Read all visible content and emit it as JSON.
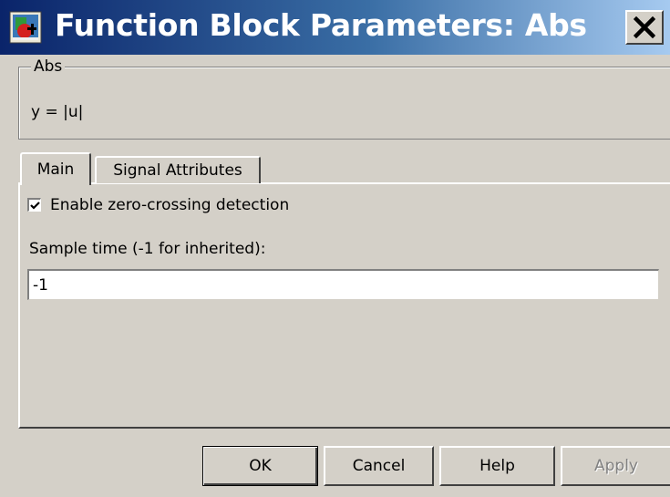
{
  "window": {
    "title": "Function Block Parameters: Abs",
    "close_label": "X"
  },
  "block": {
    "name": "Abs",
    "description": "y = |u|"
  },
  "tabs": [
    {
      "label": "Main",
      "selected": true
    },
    {
      "label": "Signal Attributes",
      "selected": false
    }
  ],
  "main": {
    "zero_crossing": {
      "label": "Enable zero-crossing detection",
      "checked": true
    },
    "sample_time": {
      "label": "Sample time (-1 for inherited):",
      "value": "-1"
    }
  },
  "buttons": {
    "ok": "OK",
    "cancel": "Cancel",
    "help": "Help",
    "apply": "Apply",
    "apply_enabled": false
  },
  "icons": {
    "app": "simulink-block-icon",
    "close": "close-icon",
    "check": "checkmark-icon"
  },
  "colors": {
    "titlebar_start": "#0a246a",
    "titlebar_end": "#a6caf0",
    "dialog_bg": "#d4d0c8"
  }
}
